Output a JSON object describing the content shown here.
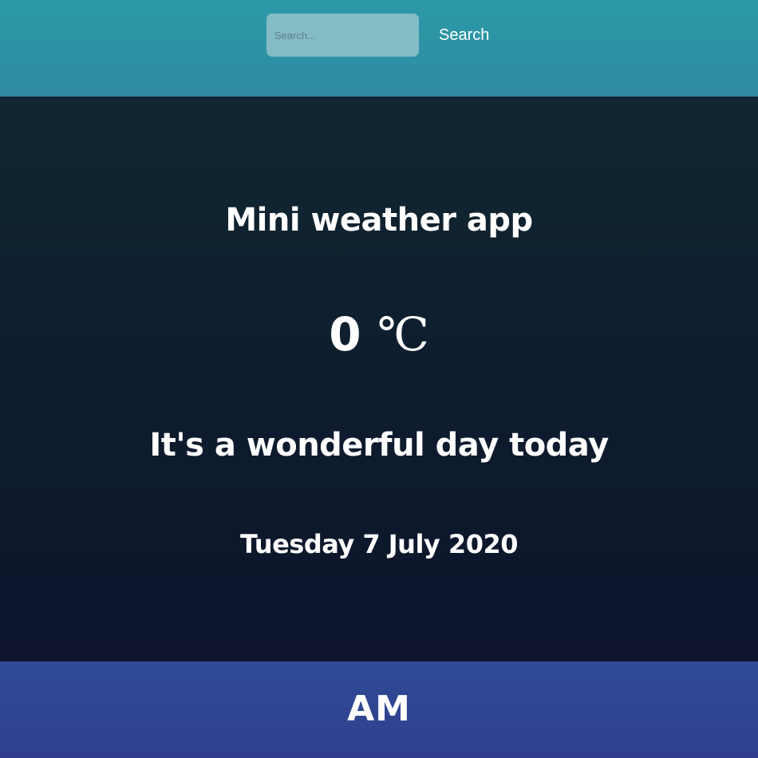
{
  "header": {
    "search_placeholder": "Search...",
    "search_value": "",
    "search_button_label": "Search",
    "accent_color": "#2c9aa6"
  },
  "main": {
    "title": "Mini weather app",
    "temperature_value": "0",
    "temperature_unit": "℃",
    "description": "It's a wonderful day today",
    "date": "Tuesday 7 July 2020",
    "background_color": "#0d1a2c"
  },
  "footer": {
    "logo_text": "AM",
    "background_color": "#2f4593"
  }
}
